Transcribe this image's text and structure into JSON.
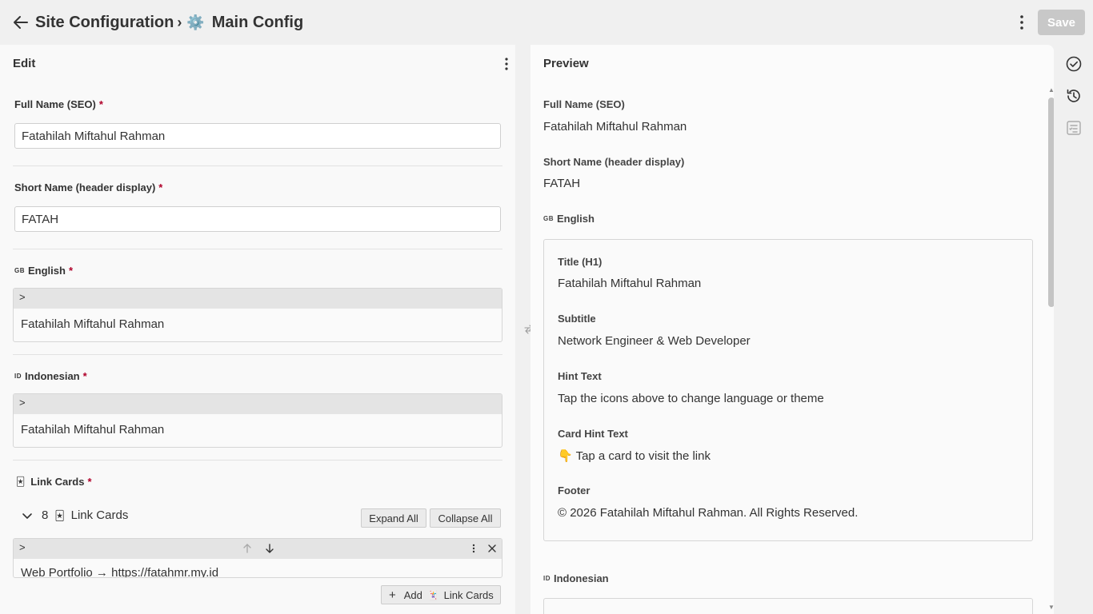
{
  "header": {
    "breadcrumb_parent": "Site Configuration",
    "breadcrumb_separator": "›",
    "config_icon": "⚙️",
    "breadcrumb_current": "Main Config",
    "save_label": "Save"
  },
  "edit": {
    "title": "Edit",
    "fields": {
      "full_name": {
        "label": "Full Name (SEO)",
        "required_mark": "*",
        "value": "Fatahilah Miftahul Rahman"
      },
      "short_name": {
        "label": "Short Name (header display)",
        "required_mark": "*",
        "value": "FATAH"
      },
      "english": {
        "flag": "GB",
        "label": "English",
        "required_mark": "*",
        "expand_glyph": ">",
        "summary": "Fatahilah Miftahul Rahman"
      },
      "indonesian": {
        "flag": "ID",
        "label": "Indonesian",
        "required_mark": "*",
        "expand_glyph": ">",
        "summary": "Fatahilah Miftahul Rahman"
      },
      "link_cards": {
        "icon": "🃏",
        "label": "Link Cards",
        "required_mark": "*",
        "count": "8",
        "list_label": "Link Cards",
        "expand_all_label": "Expand All",
        "collapse_all_label": "Collapse All",
        "items": [
          {
            "expand_glyph": ">",
            "summary": "Web Portfolio → https://fatahmr.my.id"
          }
        ],
        "add_label": "Add",
        "add_symbol": "+",
        "add_item_label": "Link Cards"
      }
    }
  },
  "preview": {
    "title": "Preview",
    "full_name_label": "Full Name (SEO)",
    "full_name_value": "Fatahilah Miftahul Rahman",
    "short_name_label": "Short Name (header display)",
    "short_name_value": "FATAH",
    "english": {
      "flag": "GB",
      "label": "English",
      "title_label": "Title (H1)",
      "title_value": "Fatahilah Miftahul Rahman",
      "subtitle_label": "Subtitle",
      "subtitle_value": "Network Engineer & Web Developer",
      "hint_label": "Hint Text",
      "hint_value": "Tap the icons above to change language or theme",
      "card_hint_label": "Card Hint Text",
      "card_hint_value": "👇 Tap a card to visit the link",
      "footer_label": "Footer",
      "footer_value": "© 2026 Fatahilah Miftahul Rahman. All Rights Reserved."
    },
    "indonesian": {
      "flag": "ID",
      "label": "Indonesian"
    }
  },
  "rail": {
    "icons": [
      "check-circle-icon",
      "history-icon",
      "checklist-icon"
    ]
  },
  "colors": {
    "required": "#b0002a",
    "save_disabled": "#c8c8c8",
    "header_strip": "#e4e4e4"
  }
}
